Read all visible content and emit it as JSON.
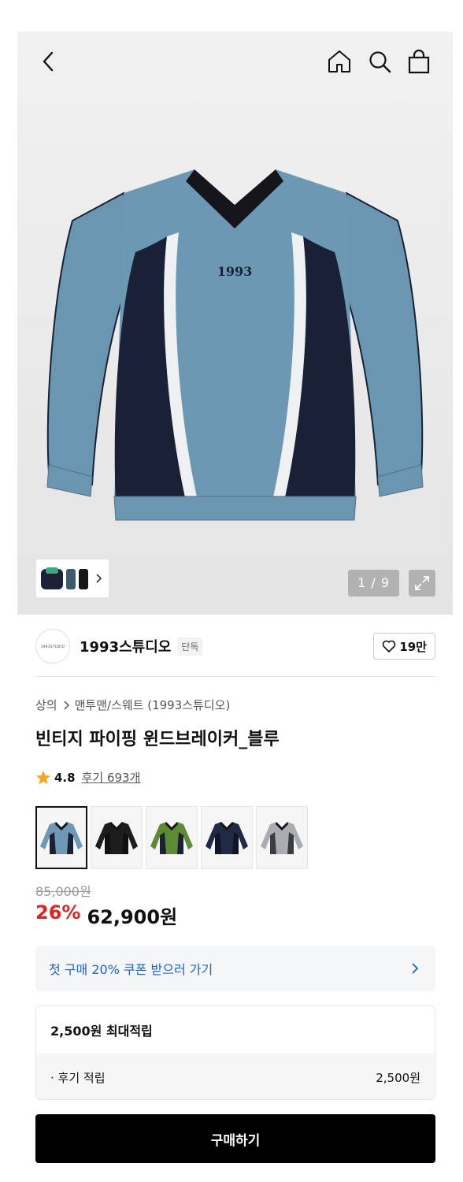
{
  "nav": {
    "back_icon": "chevron-left-icon",
    "home_icon": "home-icon",
    "search_icon": "search-icon",
    "bag_icon": "shopping-bag-icon"
  },
  "gallery": {
    "print_text": "1993",
    "pager": "1 / 9",
    "expand_icon": "expand-icon"
  },
  "brand": {
    "logo_text": "1993STUDIO",
    "name": "1993스튜디오",
    "tag": "단독",
    "likes": "19만"
  },
  "product": {
    "breadcrumb": [
      "상의",
      "맨투맨/스웨트 (1993스튜디오)"
    ],
    "title": "빈티지 파이핑 윈드브레이커_블루",
    "rating": "4.8",
    "reviews": "후기 693개"
  },
  "swatches": [
    {
      "color": "#6e98b4",
      "trim": "#1b2135",
      "selected": true
    },
    {
      "color": "#1d1d1d",
      "trim": "#101010",
      "selected": false
    },
    {
      "color": "#5c8a35",
      "trim": "#1b2135",
      "selected": false
    },
    {
      "color": "#1f2a45",
      "trim": "#0f1525",
      "selected": false
    },
    {
      "color": "#a9adb2",
      "trim": "#3a3d44",
      "selected": false
    }
  ],
  "price": {
    "original": "85,000원",
    "discount": "26%",
    "final": "62,900원"
  },
  "coupon": {
    "text": "첫 구매 20% 쿠폰 받으러 가기"
  },
  "points": {
    "header": "2,500원 최대적립",
    "row_label": "· 후기 적립",
    "row_value": "2,500원"
  },
  "buy_button": "구매하기",
  "colors": {
    "accent_red": "#e0231e",
    "link_blue": "#1f63c9",
    "star": "#f5a623"
  }
}
